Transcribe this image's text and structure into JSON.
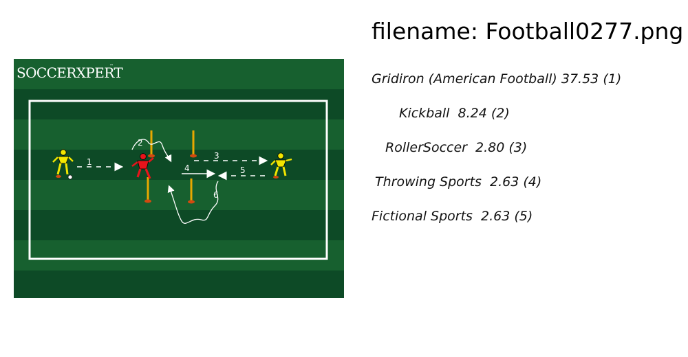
{
  "filename_text": "filename: Football0277.png",
  "predictions": [
    "Gridiron (American Football) 37.53 (1)",
    "Kickball  8.24 (2)",
    "RollerSoccer  2.80 (3)",
    "Throwing Sports  2.63 (4)",
    "Fictional Sports  2.63 (5)"
  ],
  "image": {
    "logo_text": "SOCCERXPERT",
    "logo_tm": "™",
    "step_labels": [
      "1",
      "2",
      "3",
      "4",
      "5",
      "6"
    ],
    "colors": {
      "field_dark": "#0d4a26",
      "field_light": "#17602f",
      "line": "#ffffff",
      "player_yellow": "#f2e600",
      "player_red": "#e8141b",
      "cone": "#d24a10",
      "pole": "#e8a800"
    }
  }
}
